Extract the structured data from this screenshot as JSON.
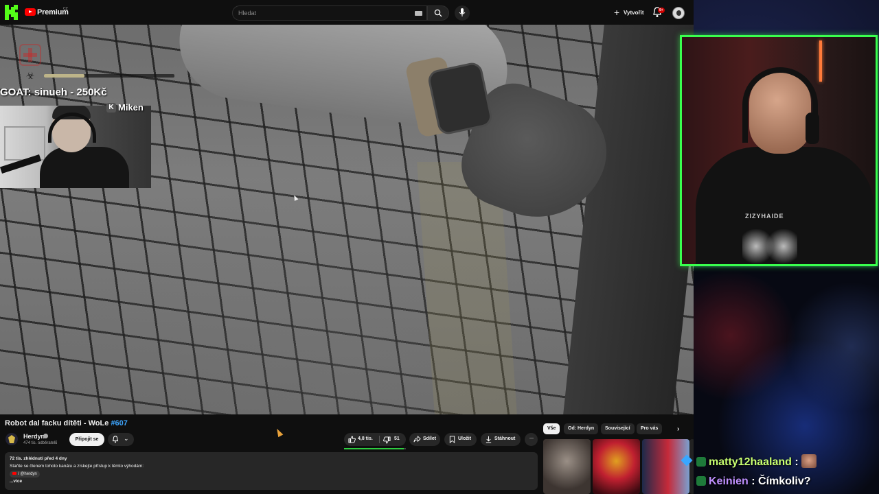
{
  "topbar": {
    "logo_letter": "K",
    "youtube_label": "Premium",
    "region": "CZ",
    "search_placeholder": "Hledat",
    "create_label": "Vytvořit",
    "notifications_badge": "9+"
  },
  "video": {
    "hud_health_level": 0.31,
    "goat_text": "GOAT: sinueh - 250Kč",
    "cam_overlay_label": "Miken",
    "cam_overlay_badge": "K"
  },
  "meta": {
    "title": "Robot dal facku dítěti - WoLe",
    "title_tag": "#607",
    "channel_name": "Herdyn",
    "channel_subs": "474 tis. odběratelů",
    "join_label": "Připojit se",
    "likes": "4,8 tis.",
    "like_ratio": 0.97,
    "dislikes": "51",
    "share_label": "Sdílet",
    "save_label": "Uložit",
    "download_label": "Stáhnout",
    "more_label": "···"
  },
  "description": {
    "views_date": "72 tis. zhlédnutí  před 4 dny",
    "line1": "Staňte se členem tohoto kanálu a získejte přístup k těmto výhodám:",
    "handle": "/ @herdyn",
    "more": "...více"
  },
  "related": {
    "chips": [
      "Vše",
      "Od: Herdyn",
      "Související",
      "Pro vás"
    ],
    "active_chip": "Vše",
    "next_label": "›"
  },
  "stream": {
    "shirt_text": "ZIZYHAIDE",
    "chat": [
      {
        "user": "matty12haaland",
        "sep": " :",
        "message": "",
        "color": "#c8ff70"
      },
      {
        "user": "Keinien",
        "sep": " :",
        "message": " Čímkoliv?",
        "color": "#c090ff"
      }
    ]
  },
  "colors": {
    "accent_green": "#39ff4e",
    "youtube_red": "#ff0000",
    "link_blue": "#3ea6ff"
  }
}
